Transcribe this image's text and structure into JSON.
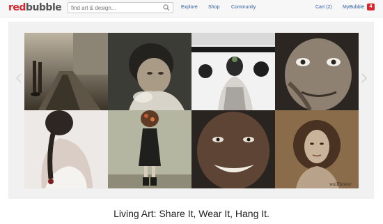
{
  "header": {
    "logo": {
      "part1": "red",
      "part2": "bubble"
    },
    "search": {
      "placeholder": "find art & design...",
      "icon": "search-icon"
    },
    "nav": {
      "explore": "Explore",
      "shop": "Shop",
      "community": "Community"
    },
    "cart": "Cart (2)",
    "account": "MyBubble",
    "notification_count": "4",
    "colors": {
      "brand_red": "#d8262e",
      "link_blue": "#2c5aa0"
    }
  },
  "slideshow": {
    "prev_icon": "chevron-left-icon",
    "next_icon": "chevron-right-icon",
    "tiles": [
      {
        "name": "railway-legs-photo"
      },
      {
        "name": "smoking-man-photo"
      },
      {
        "name": "woman-back-tattoo-photo"
      },
      {
        "name": "old-man-face-photo"
      },
      {
        "name": "braided-woman-back-photo"
      },
      {
        "name": "girl-flowers-face-photo"
      },
      {
        "name": "smiling-man-portrait-photo"
      },
      {
        "name": "vintage-woman-portrait-photo",
        "label": "wallflower"
      }
    ]
  },
  "tagline": "Living Art: Share It, Wear It, Hang It."
}
